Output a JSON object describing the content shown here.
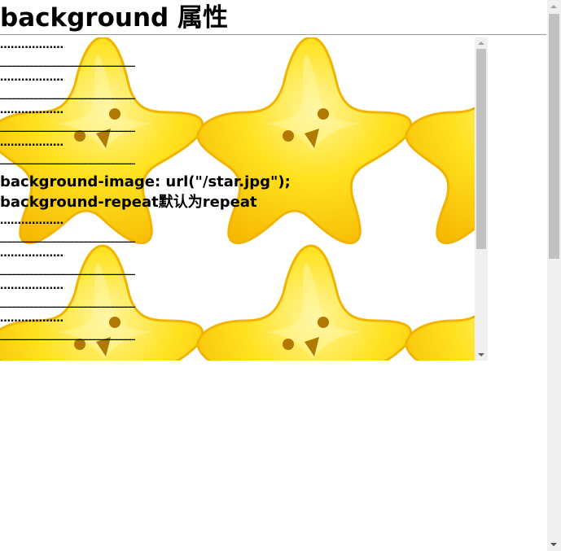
{
  "page": {
    "title": "background 属性"
  },
  "demo": {
    "dots": "………………",
    "line": "______________________________",
    "code_lines": [
      "background-image: url(\"/star.jpg\");",
      "background-repeat默认为repeat"
    ],
    "background_image_name": "star-icon",
    "star_colors": {
      "fill": "#ffd60a",
      "edge": "#f5b800",
      "face": "#b07a00"
    }
  },
  "scrollbars": {
    "track_color": "#f0f0f0",
    "thumb_color": "#c1c1c1"
  }
}
